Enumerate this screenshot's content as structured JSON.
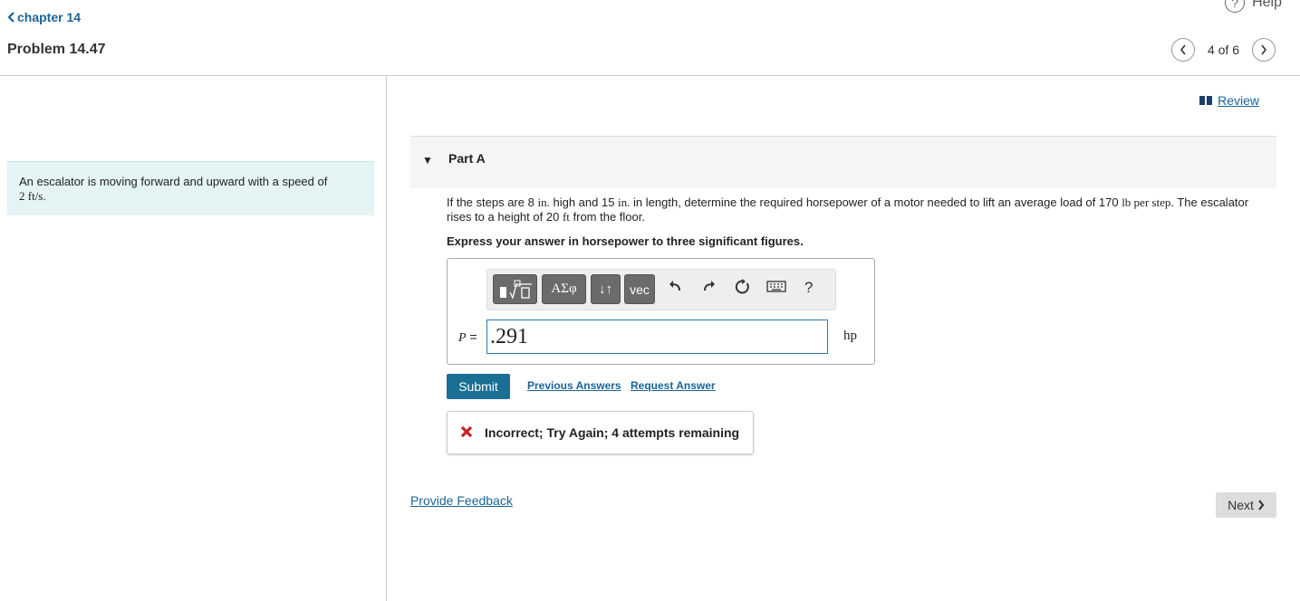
{
  "header": {
    "back_label": "chapter 14",
    "problem_title": "Problem 14.47",
    "help_label": "Help",
    "pager_text": "4 of 6"
  },
  "intro": {
    "text_prefix": "An escalator is moving forward and upward with a speed of",
    "speed": "2 ft/s."
  },
  "review_label": "Review",
  "part": {
    "title": "Part A",
    "q1": "If the steps are 8",
    "q_in1": "in.",
    "q2": "high and 15",
    "q_in2": "in.",
    "q3": "in length, determine the required horsepower of a motor needed to lift an average load of 170",
    "q_lb": "lb per step",
    "q4": ". The escalator rises to a height of 20",
    "q_ft": "ft",
    "q5": "from the floor.",
    "instruction": "Express your answer in horsepower to three significant figures."
  },
  "toolbar": {
    "greek": "ΑΣφ",
    "arrows": "↓↑",
    "vec": "vec",
    "help": "?"
  },
  "answer": {
    "variable": "P",
    "equals": "=",
    "value": ".291",
    "unit": "hp"
  },
  "actions": {
    "submit": "Submit",
    "previous_answers": "Previous Answers",
    "request_answer": "Request Answer"
  },
  "feedback": {
    "message": "Incorrect; Try Again; 4 attempts remaining"
  },
  "footer": {
    "provide_feedback": "Provide Feedback",
    "next": "Next"
  },
  "colors": {
    "accent": "#1a6f94",
    "link": "#1a6496",
    "intro_bg": "#e4f3f3",
    "error": "#c62026"
  }
}
